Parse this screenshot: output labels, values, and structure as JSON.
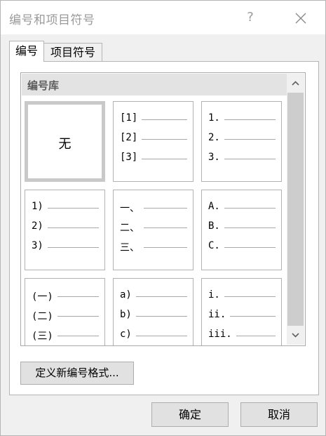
{
  "window": {
    "title": "编号和项目符号",
    "help_label": "?"
  },
  "tabs": [
    {
      "label": "编号",
      "active": true
    },
    {
      "label": "项目符号",
      "active": false
    }
  ],
  "gallery": {
    "header": "编号库",
    "tiles": [
      {
        "kind": "none",
        "label": "无",
        "selected": true
      },
      {
        "kind": "list",
        "items": [
          "[1]",
          "[2]",
          "[3]"
        ]
      },
      {
        "kind": "list",
        "items": [
          "1.",
          "2.",
          "3."
        ]
      },
      {
        "kind": "list",
        "items": [
          "1)",
          "2)",
          "3)"
        ]
      },
      {
        "kind": "list",
        "items": [
          "一、",
          "二、",
          "三、"
        ]
      },
      {
        "kind": "list",
        "items": [
          "A.",
          "B.",
          "C."
        ]
      },
      {
        "kind": "list",
        "items": [
          "(一)",
          "(二)",
          "(三)"
        ]
      },
      {
        "kind": "list",
        "items": [
          "a)",
          "b)",
          "c)"
        ]
      },
      {
        "kind": "list",
        "items": [
          "i.",
          "ii.",
          "iii."
        ]
      }
    ]
  },
  "buttons": {
    "define_new": "定义新编号格式...",
    "ok": "确定",
    "cancel": "取消"
  },
  "colors": {
    "dialog_bg": "#f0f0f0",
    "header_bg": "#e3e3e3",
    "scroll_thumb": "#cdcdcd"
  }
}
